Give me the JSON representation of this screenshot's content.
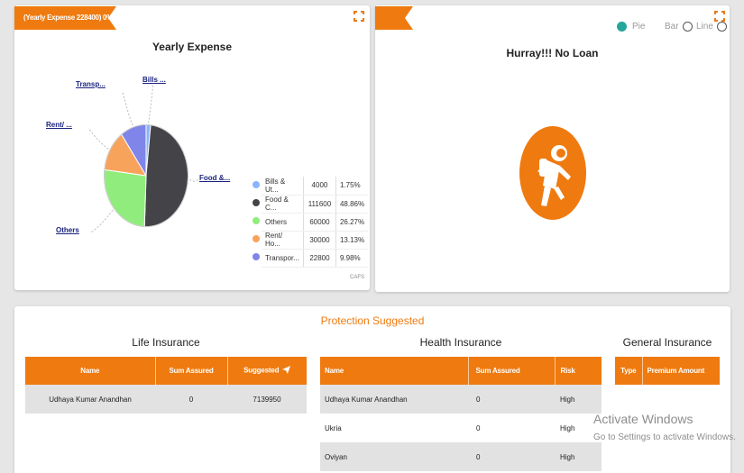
{
  "expense_card": {
    "ribbon": "(Yearly Expense 228400) 0%",
    "credit": "CAFS"
  },
  "chart_data": {
    "type": "pie",
    "title": "Yearly Expense",
    "slices": [
      {
        "label": "Bills & Ut...",
        "callout": "Bills ...",
        "value": 4000,
        "percent": "1.75%",
        "color": "#8ab4ff"
      },
      {
        "label": "Food & C...",
        "callout": "Food &...",
        "value": 111600,
        "percent": "48.86%",
        "color": "#434348"
      },
      {
        "label": "Others",
        "callout": "Others",
        "value": 60000,
        "percent": "26.27%",
        "color": "#90ed7d"
      },
      {
        "label": "Rent/ Ho...",
        "callout": "Rent/ ...",
        "value": 30000,
        "percent": "13.13%",
        "color": "#f7a35c"
      },
      {
        "label": "Transpor...",
        "callout": "Transp...",
        "value": 22800,
        "percent": "9.98%",
        "color": "#8085e9"
      }
    ]
  },
  "loan_card": {
    "message": "Hurray!!! No Loan",
    "chart_types": [
      {
        "label": "Pie",
        "selected": true
      },
      {
        "label": "Bar",
        "selected": false
      },
      {
        "label": "Line",
        "selected": false
      }
    ],
    "icon": "astronaut-icon"
  },
  "insurance": {
    "title": "Protection Suggested",
    "life": {
      "title": "Life Insurance",
      "headers": [
        "Name",
        "Sum Assured",
        "Suggested"
      ],
      "rows": [
        [
          "Udhaya Kumar Anandhan",
          "0",
          "7139950"
        ]
      ]
    },
    "health": {
      "title": "Health Insurance",
      "headers": [
        "Name",
        "Sum Assured",
        "Risk"
      ],
      "rows": [
        [
          "Udhaya Kumar Anandhan",
          "0",
          "High"
        ],
        [
          "Ukria",
          "0",
          "High"
        ],
        [
          "Oviyan",
          "0",
          "High"
        ]
      ]
    },
    "general": {
      "title": "General Insurance",
      "headers": [
        "Type",
        "Premium Amount"
      ]
    }
  },
  "watermark": {
    "line1": "Activate Windows",
    "line2": "Go to Settings to activate Windows."
  },
  "colors": {
    "accent": "#ef7a0f",
    "radio_on": "#26a69a",
    "risk": "#e53935"
  }
}
